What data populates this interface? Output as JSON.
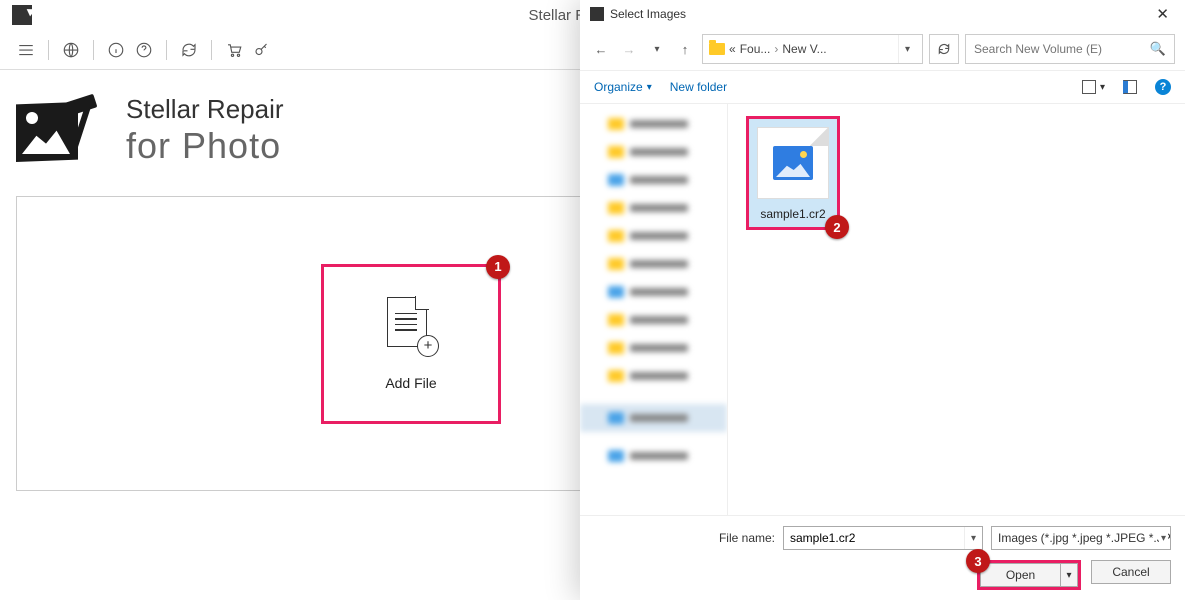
{
  "app": {
    "title": "Stellar Repair for Photo",
    "brand_line1": "Stellar Repair",
    "brand_line2": "for Photo",
    "add_file_label": "Add File"
  },
  "badges": {
    "b1": "1",
    "b2": "2",
    "b3": "3"
  },
  "dialog": {
    "title": "Select Images",
    "breadcrumb": {
      "p1": "Fou...",
      "p2": "New V..."
    },
    "search_placeholder": "Search New Volume (E)",
    "organize_label": "Organize",
    "newfolder_label": "New folder",
    "file": {
      "name": "sample1.cr2"
    },
    "footer": {
      "filename_label": "File name:",
      "filename_value": "sample1.cr2",
      "type_filter": "Images (*.jpg *.jpeg *.JPEG *.JPG",
      "open_label": "Open",
      "cancel_label": "Cancel"
    }
  },
  "colors": {
    "accent": "#e91e63",
    "badge": "#c01818"
  }
}
